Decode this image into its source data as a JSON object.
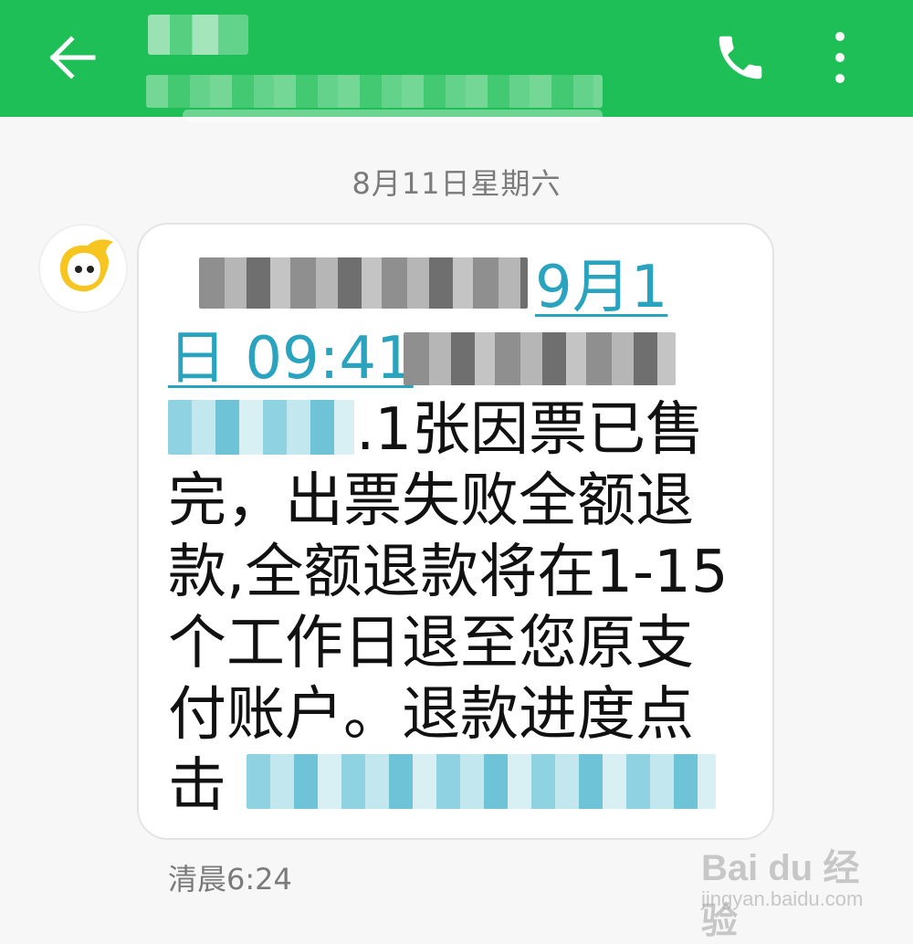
{
  "header": {
    "back_icon": "arrow-left-icon",
    "call_icon": "phone-icon",
    "more_icon": "more-vertical-icon",
    "bar_color": "#1fbf57"
  },
  "conversation": {
    "date_separator": "8月11日星期六",
    "message": {
      "lines": [
        {
          "link": "9月1"
        },
        {
          "link": "日 09:41"
        },
        {
          "text": ".1张因票已售"
        },
        {
          "text": "完，出票失败全额退"
        },
        {
          "text": "款,全额退款将在1-15"
        },
        {
          "text": "个工作日退至您原支"
        },
        {
          "text": "付账户。退款进度点"
        },
        {
          "text": "击"
        }
      ],
      "link_color": "#2aa3bf"
    },
    "timestamp": "清晨6:24"
  },
  "sender": {
    "avatar_icon": "smiley-app-icon",
    "avatar_color": "#f7c520"
  },
  "watermark": {
    "main": "Bai du 经验",
    "sub": "jingyan.baidu.com"
  }
}
